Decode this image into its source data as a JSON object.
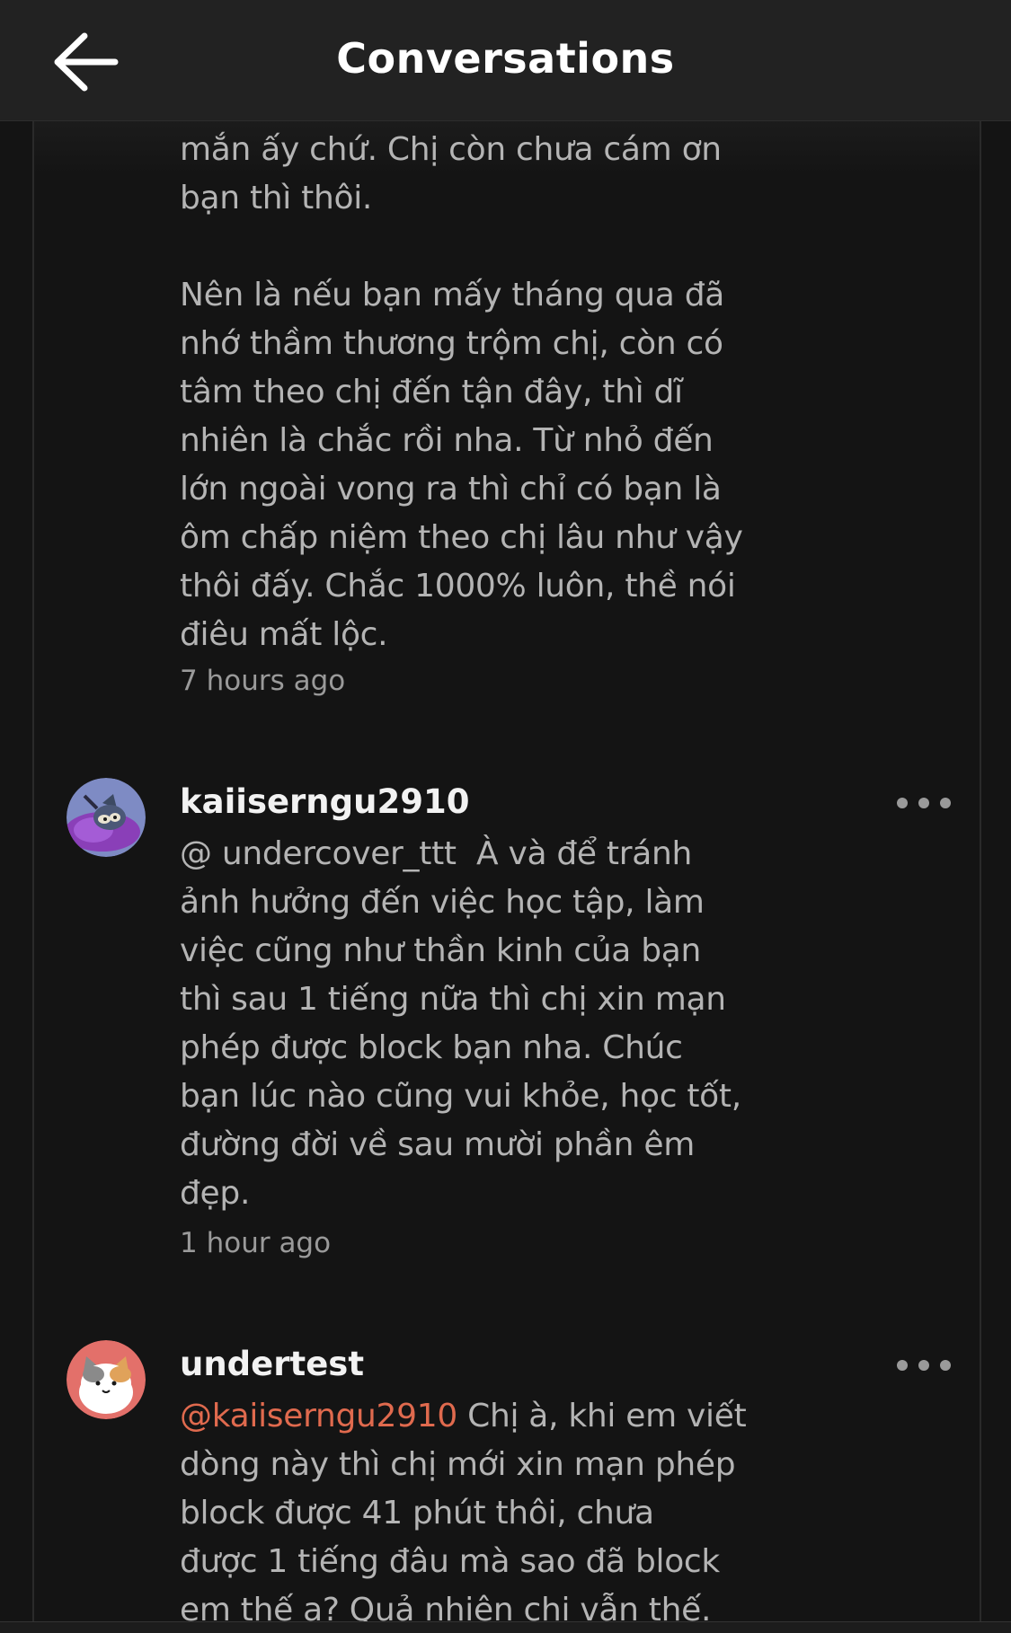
{
  "header": {
    "title": "Conversations",
    "back_icon": "arrow-left-icon"
  },
  "thread": {
    "first_fragment": {
      "text": "mắn ấy chứ. Chị còn chưa cám ơn\nbạn thì thôi.\n\nNên là nếu bạn mấy tháng qua đã\nnhớ thầm thương trộm chị, còn có\ntâm theo chị đến tận đây, thì dĩ\nnhiên là chắc rồi nha. Từ nhỏ đến\nlớn ngoài vong ra thì chỉ có bạn là\nôm chấp niệm theo chị lâu như vậy\nthôi đấy. Chắc 1000% luôn, thề nói\nđiêu mất lộc.",
      "timestamp": "7 hours ago"
    },
    "comments": [
      {
        "username": "kaiiserngu2910",
        "avatar_icon": "cartoon-cat-avatar-icon",
        "text": "@ undercover_ttt  À và để tránh\nảnh hưởng đến việc học tập, làm\nviệc cũng như thần kinh của bạn\nthì sau 1 tiếng nữa thì chị xin mạn\nphép được block bạn nha. Chúc\nbạn lúc nào cũng vui khỏe, học tốt,\nđường đời về sau mười phần êm\nđẹp.",
        "timestamp": "1 hour ago",
        "more_icon": "more-dots-icon"
      },
      {
        "username": "undertest",
        "avatar_icon": "calico-cat-avatar-icon",
        "mention": "@kaiiserngu2910",
        "text_after_mention": " Chị à, khi em viết\ndòng này thì chị mới xin mạn phép\nblock được 41 phút thôi, chưa\nđược 1 tiếng đâu mà sao đã block\nem thế ạ? Quả nhiên chị vẫn thế.",
        "more_icon": "more-dots-icon"
      }
    ]
  },
  "colors": {
    "background": "#141414",
    "header_bg": "#222222",
    "text": "#b4b4b4",
    "username": "#f2f2f2",
    "mention": "#e06a4e",
    "timestamp": "#9a9a9a"
  }
}
